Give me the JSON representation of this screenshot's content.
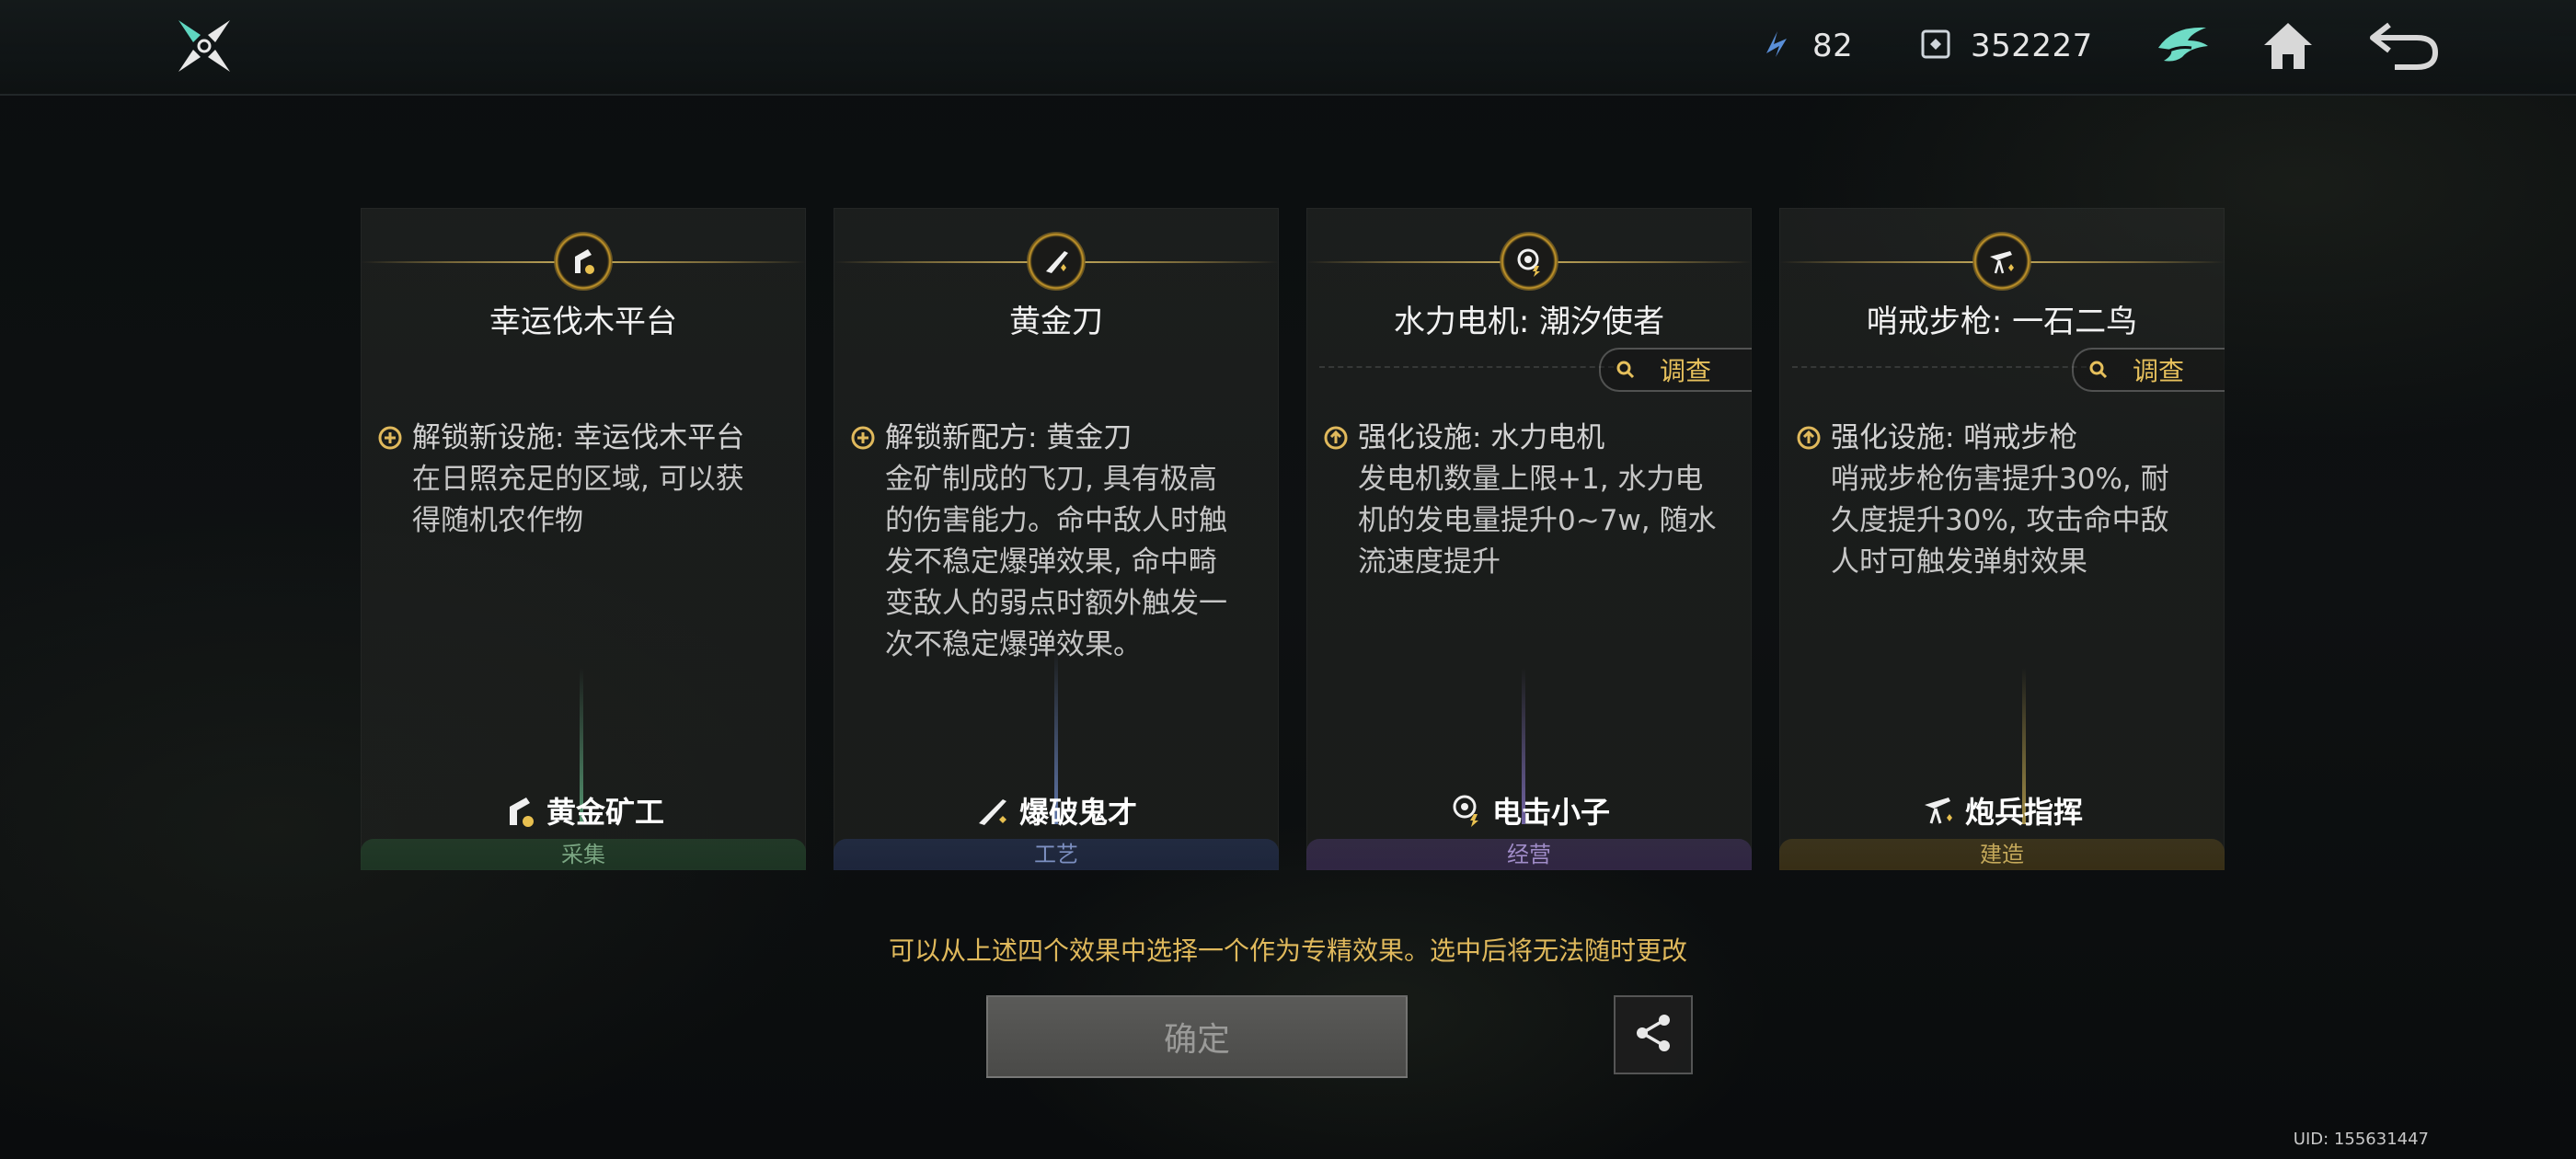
{
  "topbar": {
    "resource_1_value": "82",
    "resource_2_value": "352227"
  },
  "cards": [
    {
      "title": "幸运伐木平台",
      "desc_head": "解锁新设施: 幸运伐木平台",
      "desc_body": [
        "在日照充足的区域, 可以获",
        "得随机农作物"
      ],
      "role": "黄金矿工",
      "category": "采集"
    },
    {
      "title": "黄金刀",
      "desc_head": "解锁新配方: 黄金刀",
      "desc_body": [
        "金矿制成的飞刀, 具有极高",
        "的伤害能力。命中敌人时触",
        "发不稳定爆弹效果, 命中畸",
        "变敌人的弱点时额外触发一",
        "次不稳定爆弹效果。"
      ],
      "role": "爆破鬼才",
      "category": "工艺"
    },
    {
      "title": "水力电机: 潮汐使者",
      "investigate": "调查",
      "desc_head": "强化设施: 水力电机",
      "desc_body": [
        "发电机数量上限+1, 水力电",
        "机的发电量提升0~7w, 随水",
        "流速度提升"
      ],
      "role": "电击小子",
      "category": "经营"
    },
    {
      "title": "哨戒步枪: 一石二鸟",
      "investigate": "调查",
      "desc_head": "强化设施: 哨戒步枪",
      "desc_body": [
        "哨戒步枪伤害提升30%, 耐",
        "久度提升30%, 攻击命中敌",
        "人时可触发弹射效果"
      ],
      "role": "炮兵指挥",
      "category": "建造"
    }
  ],
  "hint": "可以从上述四个效果中选择一个作为专精效果。选中后将无法随时更改",
  "confirm_label": "确定",
  "uid": "UID: 155631447",
  "icons": {
    "logo": "shuriken-logo-icon",
    "resource_1": "energy-chip-icon",
    "resource_2": "currency-chip-icon",
    "guild": "wing-emblem-icon",
    "home": "home-icon",
    "back": "return-arrow-icon",
    "share": "share-icon"
  },
  "colors": {
    "accent_gold": "#e0b95c",
    "gather": "#7aa582",
    "craft": "#7d90c2",
    "manage": "#a08cc8",
    "build": "#c4a85a"
  }
}
